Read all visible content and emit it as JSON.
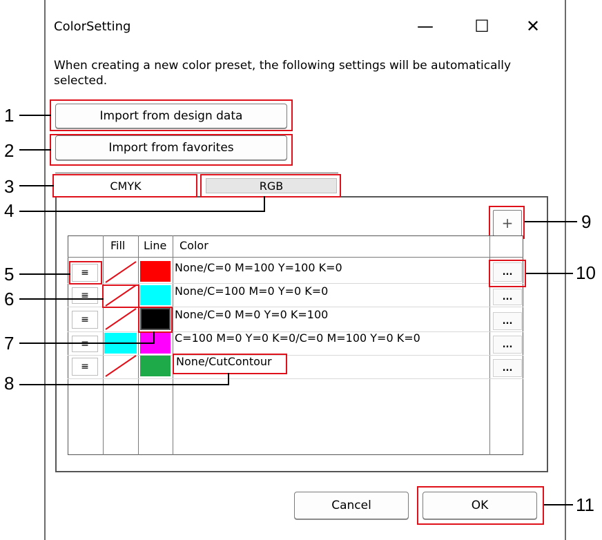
{
  "window": {
    "title": "ColorSetting",
    "minimize_glyph": "—",
    "maximize_glyph": "☐",
    "close_glyph": "✕"
  },
  "description": "When creating a new color preset, the following settings will be automatically selected.",
  "buttons": {
    "import_design": "Import from design data",
    "import_favorites": "Import from favorites",
    "add": "+",
    "cancel": "Cancel",
    "ok": "OK"
  },
  "tabs": [
    {
      "label": "CMYK",
      "selected": true
    },
    {
      "label": "RGB",
      "selected": false
    }
  ],
  "table": {
    "headers": {
      "handle": "",
      "fill": "Fill",
      "line": "Line",
      "color": "Color"
    },
    "rows": [
      {
        "handle": "≡",
        "fill": "none",
        "line_color": "#ff0000",
        "color_text": "None/C=0 M=100 Y=100 K=0",
        "more": "..."
      },
      {
        "handle": "≡",
        "fill": "none",
        "line_color": "#00ffff",
        "color_text": "None/C=100 M=0 Y=0 K=0",
        "more": "..."
      },
      {
        "handle": "≡",
        "fill": "none",
        "line_color": "#000000",
        "color_text": "None/C=0 M=0 Y=0 K=100",
        "more": "..."
      },
      {
        "handle": "≡",
        "fill": "#00ffff",
        "line_color": "#ff00ff",
        "color_text": "C=100 M=0 Y=0 K=0/C=0 M=100 Y=0 K=0",
        "more": "..."
      },
      {
        "handle": "≡",
        "fill": "none",
        "line_color": "#1faa4a",
        "color_text": "None/CutContour",
        "more": "..."
      }
    ]
  },
  "callouts": [
    "1",
    "2",
    "3",
    "4",
    "5",
    "6",
    "7",
    "8",
    "9",
    "10",
    "11"
  ],
  "colors": {
    "highlight": "#e0101a",
    "window_edge": "#6a6a6a"
  }
}
